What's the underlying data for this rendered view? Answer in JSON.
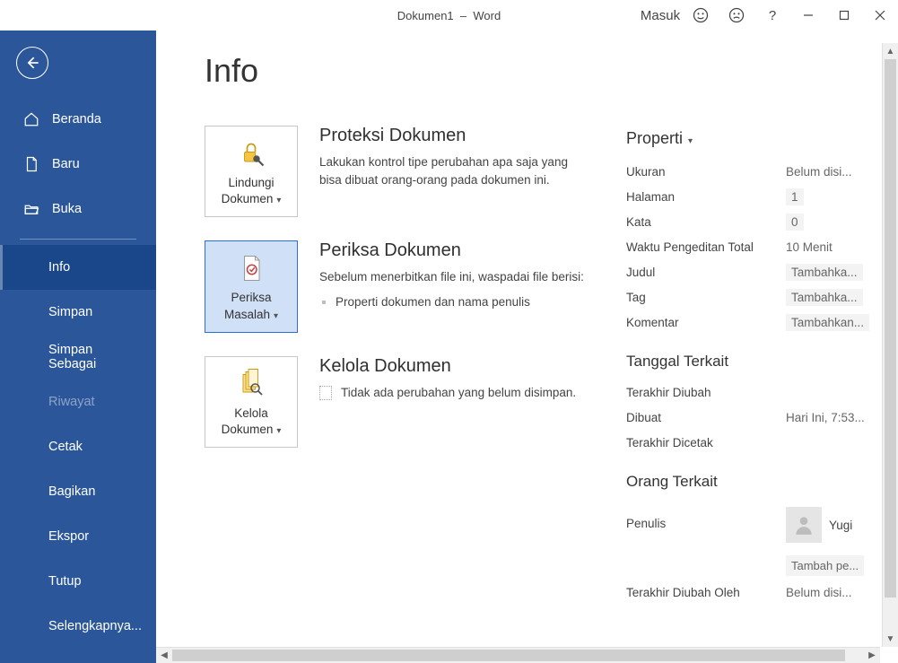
{
  "titlebar": {
    "doc": "Dokumen1",
    "dash": "–",
    "app": "Word",
    "signin": "Masuk"
  },
  "sidebar": {
    "top": [
      {
        "label": "Beranda"
      },
      {
        "label": "Baru"
      },
      {
        "label": "Buka"
      }
    ],
    "sub": [
      {
        "label": "Info",
        "selected": true
      },
      {
        "label": "Simpan"
      },
      {
        "label": "Simpan Sebagai"
      },
      {
        "label": "Riwayat",
        "disabled": true
      },
      {
        "label": "Cetak"
      },
      {
        "label": "Bagikan"
      },
      {
        "label": "Ekspor"
      },
      {
        "label": "Tutup"
      },
      {
        "label": "Selengkapnya..."
      }
    ]
  },
  "page": {
    "title": "Info"
  },
  "cards": {
    "protect": {
      "btn": "Lindungi Dokumen",
      "heading": "Proteksi Dokumen",
      "body": "Lakukan kontrol tipe perubahan apa saja yang bisa dibuat orang-orang pada dokumen ini."
    },
    "inspect": {
      "btn": "Periksa Masalah",
      "heading": "Periksa Dokumen",
      "body": "Sebelum menerbitkan file ini, waspadai file berisi:",
      "item1": "Properti dokumen dan nama penulis"
    },
    "manage": {
      "btn": "Kelola Dokumen",
      "heading": "Kelola Dokumen",
      "body": "Tidak ada perubahan yang belum disimpan."
    }
  },
  "props": {
    "heading": "Properti",
    "rows": {
      "size_k": "Ukuran",
      "size_v": "Belum disi...",
      "pages_k": "Halaman",
      "pages_v": "1",
      "words_k": "Kata",
      "words_v": "0",
      "edit_k": "Waktu Pengeditan Total",
      "edit_v": "10 Menit",
      "title_k": "Judul",
      "title_v": "Tambahka...",
      "tag_k": "Tag",
      "tag_v": "Tambahka...",
      "comment_k": "Komentar",
      "comment_v": "Tambahkan..."
    },
    "dates": {
      "heading": "Tanggal Terkait",
      "modified_k": "Terakhir Diubah",
      "modified_v": "",
      "created_k": "Dibuat",
      "created_v": "Hari Ini, 7:53...",
      "printed_k": "Terakhir Dicetak",
      "printed_v": ""
    },
    "people": {
      "heading": "Orang Terkait",
      "author_k": "Penulis",
      "author_name": "Yugi",
      "add_author": "Tambah pe...",
      "lastmod_k": "Terakhir Diubah Oleh",
      "lastmod_v": "Belum disi..."
    }
  }
}
